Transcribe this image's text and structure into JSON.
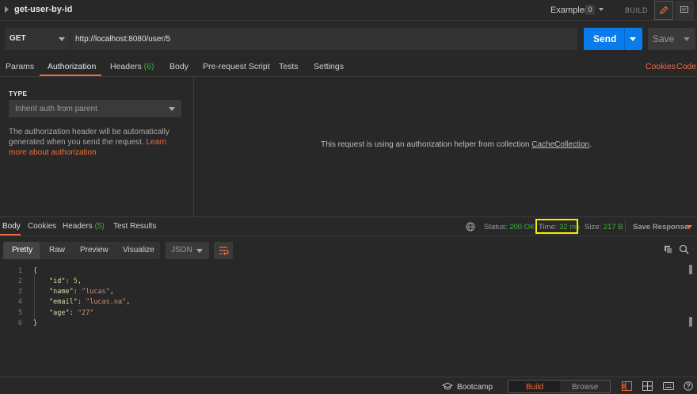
{
  "header": {
    "request_name": "get-user-by-id",
    "examples_label": "Examples",
    "examples_count": "0",
    "build_label": "BUILD"
  },
  "url_bar": {
    "method": "GET",
    "url": "http://localhost:8080/user/5",
    "send_label": "Send",
    "save_label": "Save"
  },
  "request_tabs": [
    {
      "label": "Params"
    },
    {
      "label": "Authorization",
      "active": true
    },
    {
      "label": "Headers",
      "count": "(6)"
    },
    {
      "label": "Body"
    },
    {
      "label": "Pre-request Script"
    },
    {
      "label": "Tests"
    },
    {
      "label": "Settings"
    }
  ],
  "request_links": {
    "cookies": "Cookies",
    "code": "Code"
  },
  "auth": {
    "type_label": "TYPE",
    "type_value": "Inherit auth from parent",
    "description": "The authorization header will be automatically generated when you send the request.",
    "learn_more": "Learn more about authorization",
    "helper_text": "This request is using an authorization helper from collection",
    "helper_collection": "CacheCollection",
    "helper_suffix": "."
  },
  "response_tabs": [
    {
      "label": "Body",
      "active": true
    },
    {
      "label": "Cookies"
    },
    {
      "label": "Headers",
      "count": "(5)"
    },
    {
      "label": "Test Results"
    }
  ],
  "response_meta": {
    "status_label": "Status:",
    "status_value": "200 OK",
    "time_label": "Time:",
    "time_value": "32 ms",
    "size_label": "Size:",
    "size_value": "217 B",
    "save_response": "Save Response"
  },
  "format_toolbar": {
    "modes": [
      "Pretty",
      "Raw",
      "Preview",
      "Visualize"
    ],
    "active_mode": "Pretty",
    "language": "JSON"
  },
  "response_body": {
    "line_numbers": [
      "1",
      "2",
      "3",
      "4",
      "5",
      "6"
    ],
    "open_brace": "{",
    "close_brace": "}",
    "fields": [
      {
        "key": "\"id\"",
        "value": "5",
        "value_type": "number",
        "trail": ","
      },
      {
        "key": "\"name\"",
        "value": "\"lucas\"",
        "value_type": "string",
        "trail": ","
      },
      {
        "key": "\"email\"",
        "value": "\"lucas.na\"",
        "value_type": "string",
        "trail": ","
      },
      {
        "key": "\"age\"",
        "value": "\"27\"",
        "value_type": "string",
        "trail": ""
      }
    ]
  },
  "status_bar": {
    "bootcamp": "Bootcamp",
    "build": "Build",
    "browse": "Browse"
  },
  "colors": {
    "accent": "#f26b3a",
    "send_blue": "#097bed",
    "success_green": "#3fae3f",
    "highlight_yellow": "#ffeb00",
    "background": "#282828"
  }
}
